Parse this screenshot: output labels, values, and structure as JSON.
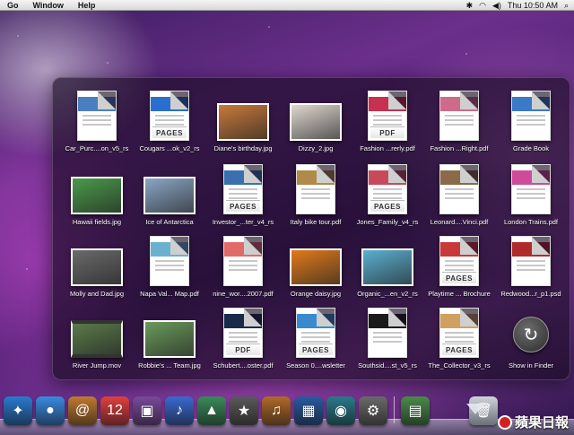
{
  "menubar": {
    "menus": [
      "Go",
      "Window",
      "Help"
    ],
    "clock": "Thu 10:50 AM"
  },
  "stack": {
    "items": [
      {
        "label": "Car_Purc....on_v5_rs",
        "kind": "doc",
        "color": "#4a7fbf"
      },
      {
        "label": "Cougars ...ok_v2_rs",
        "kind": "pages",
        "color": "#2a6fd0",
        "badge": "PAGES"
      },
      {
        "label": "Diane's birthday.jpg",
        "kind": "photo",
        "color": "#c87a3a"
      },
      {
        "label": "Dizzy_2.jpg",
        "kind": "photo",
        "color": "#e0d8d0"
      },
      {
        "label": "Fashion ...rerly.pdf",
        "kind": "pdf",
        "color": "#c83050",
        "badge": "PDF"
      },
      {
        "label": "Fashion ...Right.pdf",
        "kind": "pdf",
        "color": "#d06a8a"
      },
      {
        "label": "Grade Book",
        "kind": "doc",
        "color": "#3a7ac8"
      },
      {
        "label": "Hawaii fields.jpg",
        "kind": "photo",
        "color": "#4a9a4a"
      },
      {
        "label": "Ice of Antarctica",
        "kind": "photo",
        "color": "#8aa6c4"
      },
      {
        "label": "Investor_...ter_v4_rs",
        "kind": "pages",
        "color": "#3a70b0",
        "badge": "PAGES"
      },
      {
        "label": "Italy bike tour.pdf",
        "kind": "doc",
        "color": "#b08a4a"
      },
      {
        "label": "Jones_Family_v4_rs",
        "kind": "pages",
        "color": "#c84a5a",
        "badge": "PAGES"
      },
      {
        "label": "Leonard....Vinci.pdf",
        "kind": "doc",
        "color": "#8a6a4a"
      },
      {
        "label": "London Trains.pdf",
        "kind": "doc",
        "color": "#d04a9a"
      },
      {
        "label": "Molly and Dad.jpg",
        "kind": "photo",
        "color": "#6a6a6a"
      },
      {
        "label": "Napa Val... Map.pdf",
        "kind": "doc",
        "color": "#6ab0d0"
      },
      {
        "label": "nine_wor....2007.pdf",
        "kind": "doc",
        "color": "#e06a6a"
      },
      {
        "label": "Orange daisy.jpg",
        "kind": "photo",
        "color": "#e07a1a"
      },
      {
        "label": "Organic_...en_v2_rs",
        "kind": "photo",
        "color": "#5ab0d0"
      },
      {
        "label": "Playtime ... Brochure",
        "kind": "pages",
        "color": "#c83a3a",
        "badge": "PAGES"
      },
      {
        "label": "Redwood...r_p1.psd",
        "kind": "doc",
        "color": "#b02a2a"
      },
      {
        "label": "River Jump.mov",
        "kind": "movie",
        "color": "#5a7a4a"
      },
      {
        "label": "Robbie's ... Team.jpg",
        "kind": "photo",
        "color": "#6a9a5a"
      },
      {
        "label": "Schubert....oster.pdf",
        "kind": "pdf",
        "color": "#1a2a4a",
        "badge": "PDF"
      },
      {
        "label": "Season 0....wsletter",
        "kind": "pages",
        "color": "#3a8ad0",
        "badge": "PAGES"
      },
      {
        "label": "Southsid....st_v5_rs",
        "kind": "doc",
        "color": "#1a1a1a"
      },
      {
        "label": "The_Collector_v3_rs",
        "kind": "pages",
        "color": "#d0a060",
        "badge": "PAGES"
      },
      {
        "label": "Show in Finder",
        "kind": "finder"
      }
    ]
  },
  "dock": {
    "icons": [
      {
        "name": "safari-icon",
        "glyph": "✦",
        "color": "#2a7ad0"
      },
      {
        "name": "ichat-icon",
        "glyph": "●",
        "color": "#3a8ae0"
      },
      {
        "name": "address-book-icon",
        "glyph": "@",
        "color": "#c07a30"
      },
      {
        "name": "ical-icon",
        "glyph": "12",
        "color": "#e04040"
      },
      {
        "name": "photo-booth-icon",
        "glyph": "▣",
        "color": "#7a4a9a"
      },
      {
        "name": "itunes-icon",
        "glyph": "♪",
        "color": "#3a6ad0"
      },
      {
        "name": "iphoto-icon",
        "glyph": "▲",
        "color": "#3a8a5a"
      },
      {
        "name": "imovie-icon",
        "glyph": "★",
        "color": "#5a5a5a"
      },
      {
        "name": "garageband-icon",
        "glyph": "♫",
        "color": "#b06a2a"
      },
      {
        "name": "spaces-icon",
        "glyph": "▦",
        "color": "#2a5aa0"
      },
      {
        "name": "time-machine-icon",
        "glyph": "◉",
        "color": "#2a7a8a"
      },
      {
        "name": "system-preferences-icon",
        "glyph": "⚙",
        "color": "#6a6a6a"
      },
      {
        "name": "documents-stack-icon",
        "glyph": "▤",
        "color": "#4a8a4a"
      }
    ],
    "trash_glyph": "🗑"
  },
  "watermark": {
    "text": "蘋果日報"
  }
}
